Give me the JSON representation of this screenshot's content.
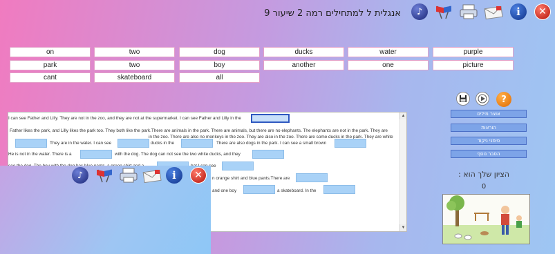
{
  "title": "אנגלית ל למתחילים רמה 2 שיעור 9",
  "toolbar": {
    "icons": [
      "music-icon",
      "flags-icon",
      "printer-icon",
      "mail-icon",
      "info-icon",
      "close-icon"
    ],
    "info_glyph": "i",
    "close_glyph": "✕",
    "music_glyph": "♪",
    "flags_glyph": "⚑⚑"
  },
  "word_bank": {
    "words": [
      "on",
      "two",
      "dog",
      "ducks",
      "water",
      "purple",
      "park",
      "two",
      "boy",
      "another",
      "one",
      "picture",
      "cant",
      "skateboard",
      "all"
    ]
  },
  "passage": {
    "line1": "I can see Father and Lilly. They are not in the zoo, and they are not at the supermarket. I can see Father and Lilly in the",
    "line2": "Father likes the park, and Lilly likes the park too. They both like the park.There are animals in the park. There are animals, but there are no elephants. The elephants are not in the park. They are",
    "line3": "in the zoo. There are also no monkeys in the zoo. They are also in the zoo. There are some ducks in the park. They are white",
    "line4a": "They are in the water. I can see",
    "line4b": "ducks in the",
    "line4c": "There are also dogs in the park. I can see a small brown",
    "line5a": "He is not in the water. There is a",
    "line5b": "with the dog. The dog can not see the two white ducks, and they",
    "line6a": "see the dog. The boy with the dog has blue pants, a green shirt and a",
    "line6b": "hat.I can see",
    "line7a": "n orange shirt and blue pants.There are",
    "line8a": "and one boy",
    "line8b": "a skateboard. In the"
  },
  "side_panel": {
    "icons": [
      "save-icon",
      "play-icon",
      "help-icon"
    ],
    "help_glyph": "?",
    "buttons": [
      "אוצר מילים",
      "הוראות",
      "סימני ניקוד",
      "הסבר נוסף"
    ],
    "score_label": "הציון שלך הוא :",
    "score_value": "0"
  },
  "colors": {
    "blank_fill": "#a9d2f7",
    "button_fill": "#7da4e8",
    "word_border": "#e3a0c8"
  }
}
